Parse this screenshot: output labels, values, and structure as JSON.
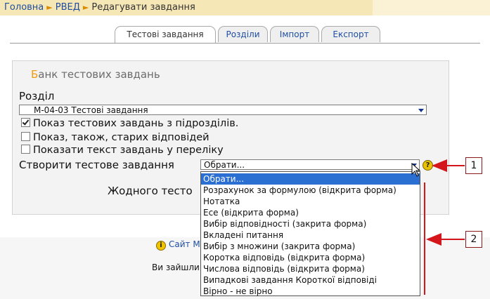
{
  "breadcrumb": {
    "items": [
      "Головна",
      "РВЕД",
      "Редагувати завдання"
    ],
    "separator": "►"
  },
  "tabs": [
    {
      "label": "Тестові завдання",
      "active": true
    },
    {
      "label": "Розділи",
      "active": false
    },
    {
      "label": "Імпорт",
      "active": false
    },
    {
      "label": "Експорт",
      "active": false
    }
  ],
  "panel": {
    "title_first_letter": "Б",
    "title_rest": "анк тестових завдань",
    "section_label": "Розділ",
    "section_value": "М-04-03 Тестові завдання",
    "checkboxes": [
      {
        "label": "Показ тестових завдань з підрозділів.",
        "checked": true
      },
      {
        "label": "Показ, також, старих відповідей",
        "checked": false
      },
      {
        "label": "Показати текст завдань у переліку",
        "checked": false
      }
    ],
    "create_label": "Створити тестове завдання",
    "create_value": "Обрати...",
    "help_icon": "help-icon",
    "none_text": "Жодного тесто"
  },
  "dropdown": {
    "options": [
      "Обрати...",
      "Розрахунок за формулою (відкрита форма)",
      "Нотатка",
      "Есе (відкрита форма)",
      "Вибір відповідності (закрита форма)",
      "Вкладені питання",
      "Вибір з множини (закрита форма)",
      "Коротка відповідь (відкрита форма)",
      "Числова відповідь (відкрита форма)",
      "Випадкові завдання Короткої відповіді",
      "Вірно - не вірно"
    ],
    "selected_index": 0
  },
  "footer": {
    "link_text": "Сайт М",
    "text": "Ви зайшли"
  },
  "annotations": {
    "callout_1": "1",
    "callout_2": "2",
    "color": "#d4161c"
  },
  "colors": {
    "link": "#1f4ea3",
    "breadcrumb_bg": "#f6e7b6",
    "accent_orange": "#f39a0c",
    "selection": "#2a6fd1"
  }
}
